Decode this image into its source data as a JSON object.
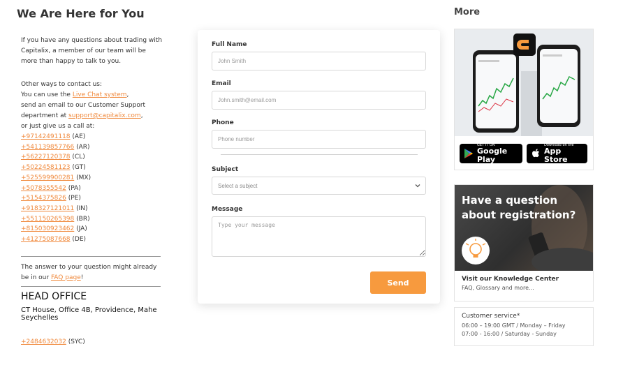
{
  "left": {
    "title": "We Are Here for You",
    "intro": "If you have any questions about trading with Capitalix, a member of our team will be more than happy to talk to you.",
    "other_ways": "Other ways to contact us:",
    "live_chat_prefix": "You can use the ",
    "live_chat_link": "Live Chat system",
    "live_chat_suffix": ",",
    "email_line1": "send an email to our Customer Support",
    "email_prefix": "department at ",
    "email_link": "support@capitalix.com",
    "email_suffix": ",",
    "call_line": "or just give us a call at:",
    "phones": [
      {
        "number": "+97142491118",
        "country": "(AE)"
      },
      {
        "number": "+541139857766",
        "country": "(AR)"
      },
      {
        "number": "+56227120378",
        "country": "(CL)"
      },
      {
        "number": "+50224581123",
        "country": "(GT)"
      },
      {
        "number": "+525599900281",
        "country": "(MX)"
      },
      {
        "number": "+5078355542",
        "country": "(PA)"
      },
      {
        "number": "+5154375826",
        "country": "(PE)"
      },
      {
        "number": "+918327121011",
        "country": "(IN)"
      },
      {
        "number": "+551150265398",
        "country": "(BR)"
      },
      {
        "number": "+815030923462",
        "country": "(JA)"
      },
      {
        "number": "+41275087668",
        "country": "(DE)"
      }
    ],
    "faq_prefix": "The answer to your question might already be in our ",
    "faq_link": "FAQ page",
    "faq_suffix": "!",
    "head_office_title": "HEAD OFFICE",
    "address": "CT House, Office 4B, Providence, Mahe Seychelles",
    "office_phone": "+2484632032",
    "office_country": "(SYC)"
  },
  "form": {
    "full_name_label": "Full Name",
    "full_name_placeholder": "John Smith",
    "email_label": "Email",
    "email_placeholder": "John.smith@email.com",
    "phone_label": "Phone",
    "phone_placeholder": "Phone number",
    "subject_label": "Subject",
    "subject_value": "Select a subject",
    "message_label": "Message",
    "message_placeholder": "Type your message",
    "send_label": "Send"
  },
  "right": {
    "title": "More",
    "google_small": "GET IT ON",
    "google_big": "Google Play",
    "apple_small": "Download on the",
    "apple_big": "App Store",
    "kc_question": "Have a question about registration?",
    "kc_title": "Visit our Knowledge Center",
    "kc_sub": "FAQ, Glossary and more...",
    "cs_title": "Customer service*",
    "cs_line1": "06:00 – 19:00 GMT / Monday – Friday",
    "cs_line2": "07:00 - 16:00 / Saturday - Sunday"
  },
  "colors": {
    "accent": "#f79a3e",
    "link": "#f0893c",
    "text": "#333333"
  }
}
